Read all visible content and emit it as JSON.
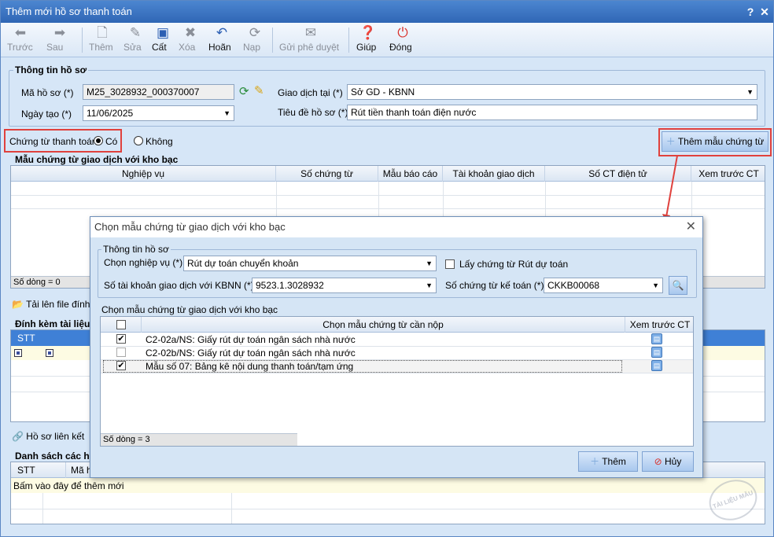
{
  "window": {
    "title": "Thêm mới hồ sơ thanh toán",
    "help_glyph": "?",
    "close_glyph": "✕"
  },
  "toolbar": {
    "back": "Trước",
    "next": "Sau",
    "add": "Thêm",
    "edit": "Sửa",
    "save": "Cất",
    "delete": "Xóa",
    "undo": "Hoãn",
    "load": "Nạp",
    "send": "Gửi phê duyệt",
    "help": "Giúp",
    "close": "Đóng"
  },
  "info": {
    "group_title": "Thông tin hồ sơ",
    "ma_ho_so_label": "Mã hồ sơ (*)",
    "ma_ho_so_value": "M25_3028932_000370007",
    "ngay_tao_label": "Ngày tạo (*)",
    "ngay_tao_value": "11/06/2025",
    "giao_dich_label": "Giao dịch tại (*)",
    "giao_dich_value": "Sở GD - KBNN",
    "tieu_de_label": "Tiêu đề hồ sơ (*)",
    "tieu_de_value": "Rút tiền thanh toán điện nước"
  },
  "payment": {
    "label": "Chứng từ thanh toán:",
    "yes": "Có",
    "no": "Không",
    "add_template_button": "Thêm mẫu chứng từ"
  },
  "templates_grid": {
    "group_title": "Mẫu chứng từ giao dịch với kho bạc",
    "columns": [
      "Nghiệp vụ",
      "Số chứng từ",
      "Mẫu báo cáo",
      "Tài khoản giao dịch",
      "Số CT điện tử",
      "Xem trước CT"
    ],
    "status": "Số dòng = 0"
  },
  "upload": {
    "label": "Tải lên file đính"
  },
  "attachments": {
    "group_title": "Đính kèm tài liệu",
    "columns": [
      "STT"
    ]
  },
  "linked": {
    "label": "Hồ sơ liên kết"
  },
  "list": {
    "group_title": "Danh sách các hồ",
    "columns": [
      "STT",
      "Mã h"
    ],
    "add_hint": "Bấm vào đây để thêm mới"
  },
  "dialog": {
    "title": "Chọn mẫu chứng từ giao dịch với kho bạc",
    "info_title": "Thông tin hồ sơ",
    "nghiep_vu_label": "Chọn nghiệp vụ (*)",
    "nghiep_vu_value": "Rút dự toán chuyển khoản",
    "lay_chung_tu_label": "Lấy chứng từ Rút dự toán",
    "tai_khoan_label": "Số tài khoản giao dịch với KBNN (*)",
    "tai_khoan_value": "9523.1.3028932",
    "so_chung_tu_label": "Số chứng từ kế toán (*)",
    "so_chung_tu_value": "CKKB00068",
    "list_title": "Chọn mẫu chứng từ giao dịch với kho bạc",
    "col_template": "Chọn mẫu chứng từ cần nộp",
    "col_preview": "Xem trước CT",
    "rows": [
      {
        "name": "C2-02a/NS: Giấy rút dự toán ngân sách nhà nước",
        "checked": true
      },
      {
        "name": "C2-02b/NS: Giấy rút dự toán ngân sách nhà nước",
        "checked": false
      },
      {
        "name": "Mẫu số 07: Bảng kê nội dung thanh toán/tạm ứng",
        "checked": true
      }
    ],
    "status": "Số dòng = 3",
    "add_button": "Thêm",
    "cancel_button": "Hủy"
  },
  "watermark": "TÀI LIỆU MẪU"
}
